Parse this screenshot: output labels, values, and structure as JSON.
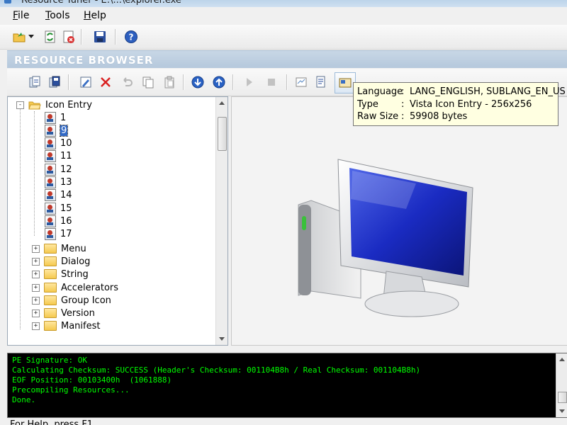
{
  "window": {
    "title": "Resource Tuner - E:\\...\\explorer.exe"
  },
  "menu": {
    "items": [
      "File",
      "Tools",
      "Help"
    ]
  },
  "section": {
    "title": "RESOURCE BROWSER"
  },
  "tree": {
    "root_label": "Icon Entry",
    "entries": [
      "1",
      "9",
      "10",
      "11",
      "12",
      "13",
      "14",
      "15",
      "16",
      "17"
    ],
    "selected": "9",
    "folders": [
      "Menu",
      "Dialog",
      "String",
      "Accelerators",
      "Group Icon",
      "Version",
      "Manifest"
    ]
  },
  "tooltip": {
    "rows": [
      {
        "key": "Language",
        "sep": ":",
        "value": "LANG_ENGLISH, SUBLANG_EN_US"
      },
      {
        "key": "Type",
        "sep": ":",
        "value": "Vista Icon Entry - 256x256"
      },
      {
        "key": "Raw Size",
        "sep": ":",
        "value": "59908 bytes"
      }
    ]
  },
  "console": {
    "lines": [
      "PE Signature: OK",
      "Calculating Checksum: SUCCESS (Header's Checksum: 001104B8h / Real Checksum: 001104B8h)",
      "EOF Position: 00103400h  (1061888)",
      "Precompiling Resources...",
      "Done."
    ]
  },
  "status": {
    "text": "For Help, press F1"
  },
  "icons": {
    "toolbar1": [
      "open-folder-icon",
      "dropdown-arrow-icon",
      "refresh-icon",
      "close-file-icon",
      "save-icon",
      "help-icon"
    ],
    "toolbar2": [
      "import-icon",
      "export-icon",
      "edit-icon",
      "delete-icon",
      "undo-icon",
      "copy-icon",
      "paste-icon",
      "arrow-down-circle-icon",
      "arrow-up-circle-icon",
      "play-icon",
      "stop-icon",
      "dialog-icon",
      "properties-icon",
      "info-icon"
    ]
  },
  "colors": {
    "console_text": "#00ff00",
    "console_bg": "#000000",
    "tooltip_bg": "#ffffe1",
    "header_bg": "#b5c8dc"
  }
}
